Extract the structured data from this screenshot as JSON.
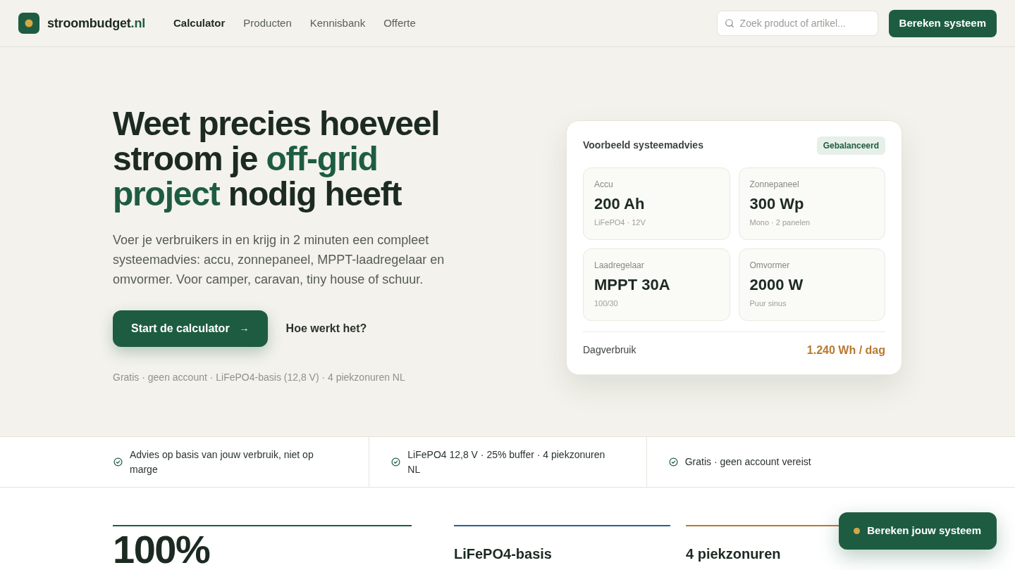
{
  "header": {
    "logo": {
      "name": "stroombudget",
      "suffix": ".nl"
    },
    "nav": [
      {
        "label": "Calculator",
        "selected": true
      },
      {
        "label": "Producten",
        "selected": false
      },
      {
        "label": "Kennisbank",
        "selected": false
      },
      {
        "label": "Offerte",
        "selected": false
      }
    ],
    "search": {
      "placeholder": "Zoek product of artikel..."
    },
    "cta": "Bereken systeem"
  },
  "hero": {
    "headline": [
      {
        "text": "Weet precies hoeveel stroom je ",
        "accent": false
      },
      {
        "text": "off-grid project",
        "accent": true
      },
      {
        "text": " nodig heeft",
        "accent": false
      }
    ],
    "intro": "Voer je verbruikers in en krijg in 2 minuten een compleet systeemadvies: accu, zonnepaneel, MPPT-laadregelaar en omvormer. Voor camper, caravan, tiny house of schuur.",
    "primary_button": {
      "label": "Start de calculator",
      "arrow": "→"
    },
    "secondary_link": "Hoe werkt het?",
    "footnote": "Gratis · geen account · LiFePO4-basis (12,8 V) · 4 piekzonuren NL"
  },
  "advice_card": {
    "title": "Voorbeeld systeemadvies",
    "badge": "Gebalanceerd",
    "items": [
      {
        "label": "Accu",
        "value": "200 Ah",
        "detail": "LiFePO4 · 12V"
      },
      {
        "label": "Zonnepaneel",
        "value": "300 Wp",
        "detail": "Mono · 2 panelen"
      },
      {
        "label": "Laadregelaar",
        "value": "MPPT 30A",
        "detail": "100/30"
      },
      {
        "label": "Omvormer",
        "value": "2000 W",
        "detail": "Puur sinus"
      }
    ],
    "summary": {
      "label": "Dagverbruik",
      "value": "1.240 Wh / dag"
    }
  },
  "benefits": [
    {
      "text": "Advies op basis van jouw verbruik, niet op marge"
    },
    {
      "text": "LiFePO4 12,8 V · 25% buffer · 4 piekzonuren NL"
    },
    {
      "text": "Gratis · geen account vereist"
    }
  ],
  "stats": [
    {
      "kind": "number",
      "text": "100%",
      "color": "#1e5c42"
    },
    {
      "kind": "title",
      "text": "LiFePO4-basis",
      "color": "#2d5f8a"
    },
    {
      "kind": "title",
      "text": "4 piekzonuren",
      "color": "#b8792e"
    }
  ],
  "floating_button": {
    "label": "Bereken jouw systeem"
  }
}
